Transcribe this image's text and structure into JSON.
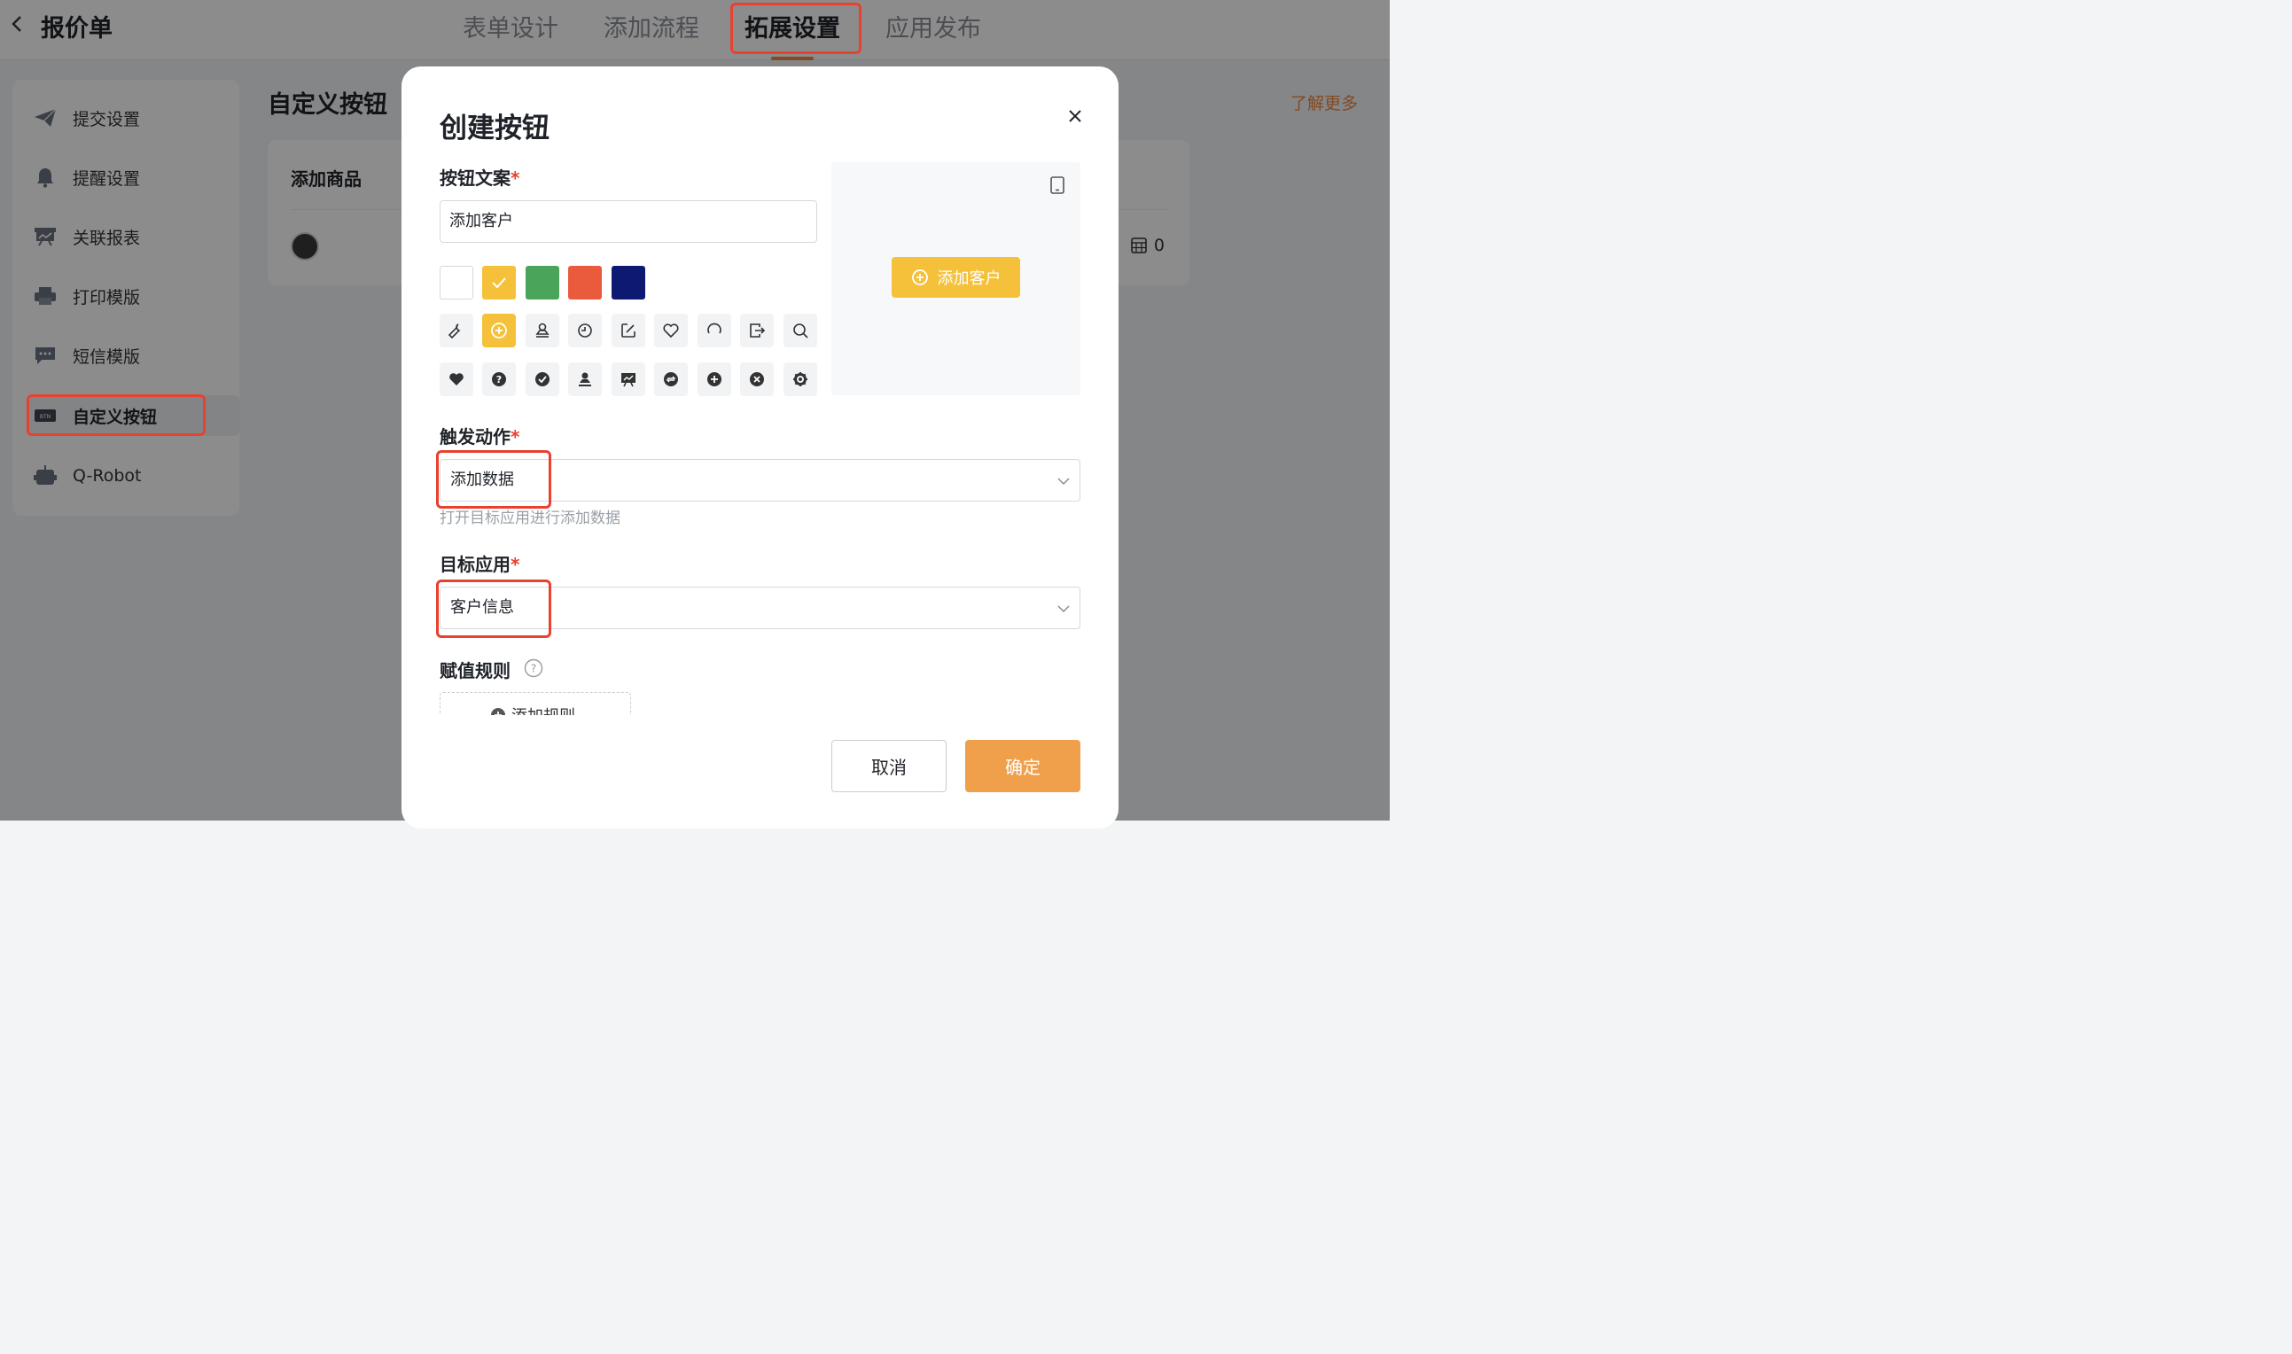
{
  "header": {
    "title": "报价单",
    "tabs": [
      "表单设计",
      "添加流程",
      "拓展设置",
      "应用发布"
    ],
    "active_tab": "拓展设置"
  },
  "sidebar": {
    "items": [
      {
        "label": "提交设置",
        "icon": "send-icon"
      },
      {
        "label": "提醒设置",
        "icon": "bell-icon"
      },
      {
        "label": "关联报表",
        "icon": "report-icon"
      },
      {
        "label": "打印模版",
        "icon": "printer-icon"
      },
      {
        "label": "短信模版",
        "icon": "sms-icon"
      },
      {
        "label": "自定义按钮",
        "icon": "btn-icon"
      },
      {
        "label": "Q-Robot",
        "icon": "robot-icon"
      }
    ],
    "active_item": "自定义按钮"
  },
  "main": {
    "title": "自定义按钮",
    "learn_more": "了解更多",
    "card": {
      "title": "添加商品",
      "count": "0"
    }
  },
  "modal": {
    "title": "创建按钮",
    "button_text_label": "按钮文案",
    "button_text_value": "添加客户",
    "colors": [
      "#ffffff",
      "#f5c13a",
      "#4aa55a",
      "#ea5a3c",
      "#0e1a72"
    ],
    "selected_color": "#f5c13a",
    "icons_row1": [
      "wrench-icon",
      "plus-circle-icon",
      "stamp-icon",
      "clock-icon",
      "edit-icon",
      "heart-outline-icon",
      "refresh-icon",
      "export-icon",
      "search-icon"
    ],
    "icons_row2": [
      "heart-icon",
      "question-icon",
      "check-icon",
      "stamp-solid-icon",
      "board-icon",
      "sync-icon",
      "plus-solid-icon",
      "close-solid-icon",
      "settings-icon"
    ],
    "preview_button_label": "添加客户",
    "trigger_label": "触发动作",
    "trigger_value": "添加数据",
    "trigger_hint": "打开目标应用进行添加数据",
    "target_label": "目标应用",
    "target_value": "客户信息",
    "assign_label": "赋值规则",
    "add_rule_label": "添加规则",
    "cancel_label": "取消",
    "confirm_label": "确定"
  },
  "colors": {
    "accent": "#f0a04b",
    "highlight": "#e8412f",
    "button_preview": "#f5c13a"
  }
}
